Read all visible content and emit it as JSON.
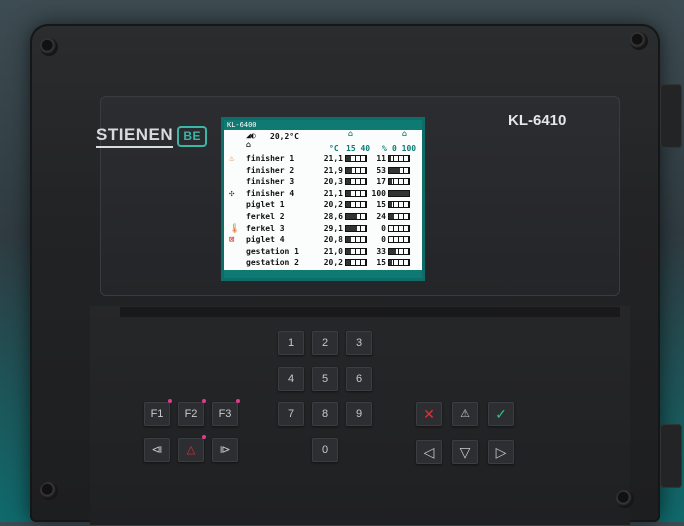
{
  "device": {
    "brand": "STIENEN",
    "brand_logo": "BE",
    "model": "KL-6410",
    "accent_color": "#0e7a73",
    "led_color": "#e03a8c"
  },
  "screen": {
    "title": "KL-6400",
    "outside_temp": "20,2°C",
    "header_units_temp": "°C",
    "header_scale_temp": "15 40",
    "header_units_pct": "%",
    "header_scale_pct": "0 100",
    "rows": [
      {
        "name": "finisher 1",
        "temp": "21,1",
        "temp_level": 0.25,
        "pct": "11",
        "pct_level": 0.11,
        "icon": "heating-icon"
      },
      {
        "name": "finisher 2",
        "temp": "21,9",
        "temp_level": 0.28,
        "pct": "53",
        "pct_level": 0.53,
        "icon": ""
      },
      {
        "name": "finisher 3",
        "temp": "20,3",
        "temp_level": 0.21,
        "pct": "17",
        "pct_level": 0.17,
        "icon": ""
      },
      {
        "name": "finisher 4",
        "temp": "21,1",
        "temp_level": 0.25,
        "pct": "100",
        "pct_level": 1.0,
        "icon": "fan-icon"
      },
      {
        "name": "piglet 1",
        "temp": "20,2",
        "temp_level": 0.21,
        "pct": "15",
        "pct_level": 0.15,
        "icon": ""
      },
      {
        "name": "ferkel 2",
        "temp": "28,6",
        "temp_level": 0.54,
        "pct": "24",
        "pct_level": 0.24,
        "icon": ""
      },
      {
        "name": "ferkel 3",
        "temp": "29,1",
        "temp_level": 0.56,
        "pct": "0",
        "pct_level": 0.0,
        "icon": "thermometer-icon"
      },
      {
        "name": "piglet 4",
        "temp": "20,8",
        "temp_level": 0.23,
        "pct": "0",
        "pct_level": 0.0,
        "icon": "alarm-off-icon"
      },
      {
        "name": "gestation 1",
        "temp": "21,0",
        "temp_level": 0.24,
        "pct": "33",
        "pct_level": 0.33,
        "icon": ""
      },
      {
        "name": "gestation 2",
        "temp": "20,2",
        "temp_level": 0.21,
        "pct": "15",
        "pct_level": 0.15,
        "icon": ""
      }
    ]
  },
  "keys": {
    "f1": "F1",
    "f2": "F2",
    "f3": "F3",
    "n1": "1",
    "n2": "2",
    "n3": "3",
    "n4": "4",
    "n5": "5",
    "n6": "6",
    "n7": "7",
    "n8": "8",
    "n9": "9",
    "n0": "0",
    "cancel": "✕",
    "plus_up": "⍋",
    "confirm": "✓",
    "rewind": "⧏",
    "alarm": "🔔",
    "forward": "⧐",
    "left": "◁",
    "down": "▽",
    "right": "▷"
  }
}
